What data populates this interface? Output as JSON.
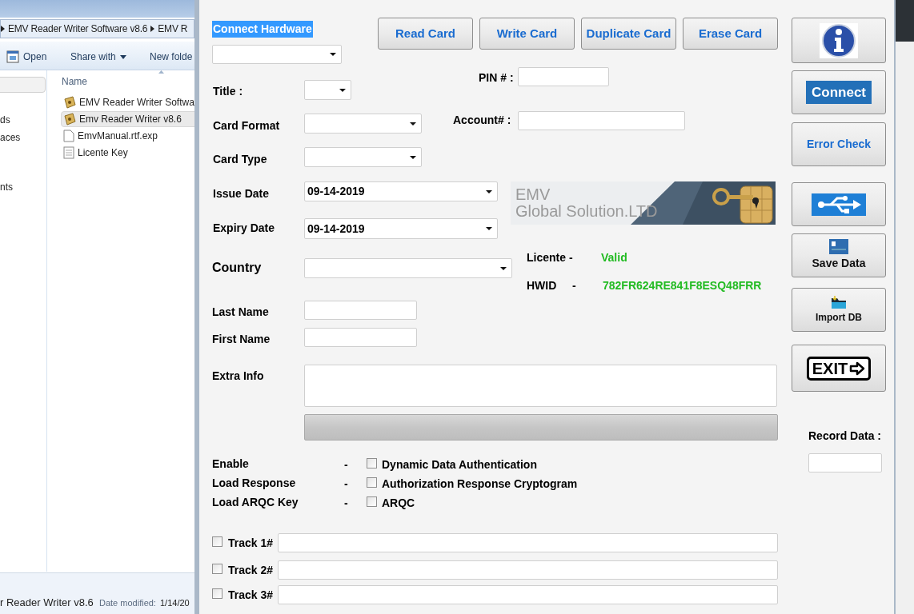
{
  "explorer": {
    "breadcrumb": [
      "EMV Reader Writer Software v8.6",
      "EMV R"
    ],
    "toolbar": [
      {
        "kind": "open",
        "label": "Open"
      },
      {
        "kind": "menu",
        "label": "Share with"
      },
      {
        "kind": "plain",
        "label": "New folde"
      }
    ],
    "nav_items": [
      "ds",
      "aces",
      "nts"
    ],
    "column": "Name",
    "files": [
      {
        "name": "EMV Reader Writer  Softwa",
        "kind": "app",
        "selected": false
      },
      {
        "name": "Emv Reader Writer v8.6",
        "kind": "app",
        "selected": true
      },
      {
        "name": "EmvManual.rtf.exp",
        "kind": "file",
        "selected": false
      },
      {
        "name": "Licente Key",
        "kind": "text",
        "selected": false
      }
    ],
    "details": {
      "name": "r Reader Writer v8.6",
      "date_label": "Date modified:",
      "date": "1/14/20"
    }
  },
  "app": {
    "connect_label": "Connect Hardware",
    "top_buttons": [
      "Read Card",
      "Write Card",
      "Duplicate Card",
      "Erase Card"
    ],
    "fields": [
      {
        "label": "Title :",
        "kind": "dropdown"
      },
      {
        "label": "Card Format",
        "kind": "dropdown"
      },
      {
        "label": "Card Type",
        "kind": "dropdown"
      },
      {
        "label": "Issue Date",
        "kind": "dropdown",
        "value": "09-14-2019"
      },
      {
        "label": "Expiry Date",
        "kind": "dropdown",
        "value": "09-14-2019"
      },
      {
        "label": "Country",
        "kind": "dropdown"
      },
      {
        "label": "Last Name",
        "kind": "text"
      },
      {
        "label": "First Name",
        "kind": "text"
      },
      {
        "label": "Extra Info",
        "kind": "textarea"
      },
      {
        "label": "PIN # :",
        "kind": "text"
      },
      {
        "label": "Account# :",
        "kind": "text"
      }
    ],
    "banner": {
      "line1": "EMV",
      "line2": "Global Solution.LTD"
    },
    "license": {
      "label": "Licente -",
      "value": "Valid"
    },
    "hwid": {
      "label": "HWID",
      "dash": "-",
      "value": "782FR624RE841F8ESQ48FRR"
    },
    "options": [
      {
        "label": "Enable",
        "dash": "-",
        "option": "Dynamic Data Authentication",
        "checked": false
      },
      {
        "label": "Load Response",
        "dash": "-",
        "option": "Authorization Response Cryptogram",
        "checked": false
      },
      {
        "label": "Load ARQC Key",
        "dash": "-",
        "option": "ARQC",
        "checked": false
      }
    ],
    "tracks": [
      {
        "label": "Track 1#",
        "checked": false
      },
      {
        "label": "Track 2#",
        "checked": false
      },
      {
        "label": "Track 3#",
        "checked": false
      }
    ],
    "side_buttons": [
      {
        "kind": "info"
      },
      {
        "kind": "boxed",
        "label": "Connect"
      },
      {
        "kind": "text",
        "label": "Error Check"
      },
      {
        "kind": "usb"
      },
      {
        "kind": "save",
        "label": "Save Data"
      },
      {
        "kind": "import",
        "label": "Import DB"
      },
      {
        "kind": "exit",
        "label": "EXIT"
      }
    ],
    "record_label": "Record Data :"
  }
}
